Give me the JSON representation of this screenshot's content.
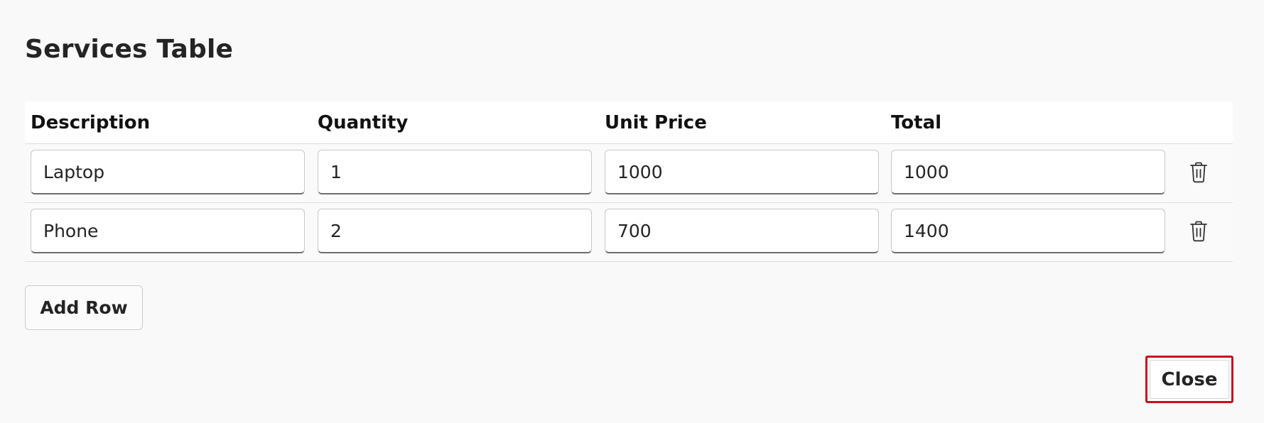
{
  "page": {
    "title": "Services Table"
  },
  "table": {
    "columns": [
      "Description",
      "Quantity",
      "Unit Price",
      "Total"
    ],
    "rows": [
      {
        "description": "Laptop",
        "quantity": "1",
        "unit_price": "1000",
        "total": "1000"
      },
      {
        "description": "Phone",
        "quantity": "2",
        "unit_price": "700",
        "total": "1400"
      }
    ],
    "row_action_icon": "trash-icon"
  },
  "actions": {
    "add_row_label": "Add Row",
    "close_label": "Close"
  },
  "colors": {
    "background": "#f9f9f9",
    "focus_outline": "#c50f1f",
    "input_border": "#c8c8c8"
  }
}
